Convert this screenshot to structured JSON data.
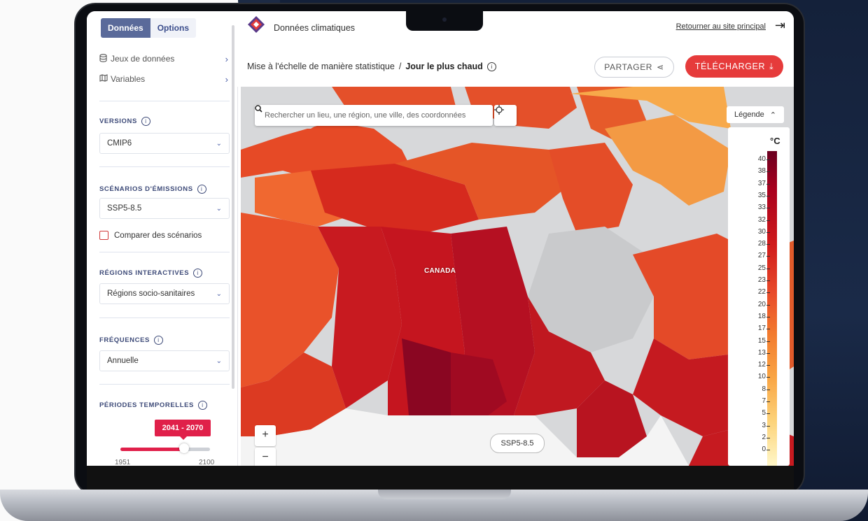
{
  "sidebar": {
    "tabs": [
      "Données",
      "Options"
    ],
    "nav": [
      {
        "label": "Jeux de données",
        "icon": "database-icon"
      },
      {
        "label": "Variables",
        "icon": "map-icon"
      }
    ],
    "versions": {
      "title": "VERSIONS",
      "value": "CMIP6"
    },
    "scenarios": {
      "title": "SCÉNARIOS D'ÉMISSIONS",
      "value": "SSP5-8.5",
      "compare_label": "Comparer des scénarios"
    },
    "regions": {
      "title": "RÉGIONS INTERACTIVES",
      "value": "Régions socio-sanitaires"
    },
    "frequencies": {
      "title": "FRÉQUENCES",
      "value": "Annuelle"
    },
    "periods": {
      "title": "PÉRIODES TEMPORELLES",
      "selected": "2041 - 2070",
      "min": "1951",
      "max": "2100"
    }
  },
  "header": {
    "app_title": "Données climatiques",
    "return_link": "Retourner au site principal",
    "breadcrumb_parent": "Mise à l'échelle de manière statistique",
    "breadcrumb_sep": "/",
    "breadcrumb_current": "Jour le plus chaud",
    "share_label": "PARTAGER",
    "download_label": "TÉLÉCHARGER"
  },
  "map": {
    "search_placeholder": "Rechercher un lieu, une région, une ville, des coordonnées",
    "legend_toggle": "Légende",
    "legend_unit": "°C",
    "legend_ticks": [
      "40",
      "38",
      "37",
      "35",
      "33",
      "32",
      "30",
      "28",
      "27",
      "25",
      "23",
      "22",
      "20",
      "18",
      "17",
      "15",
      "13",
      "12",
      "10",
      "8",
      "7",
      "5",
      "3",
      "2",
      "0"
    ],
    "country_label": "CANADA",
    "scenario_badge": "SSP5-8.5",
    "zoom_in": "+",
    "zoom_out": "−"
  },
  "colors": {
    "accent": "#e63b3b",
    "primary": "#3d4a78",
    "tab_active": "#5a6a9a"
  }
}
